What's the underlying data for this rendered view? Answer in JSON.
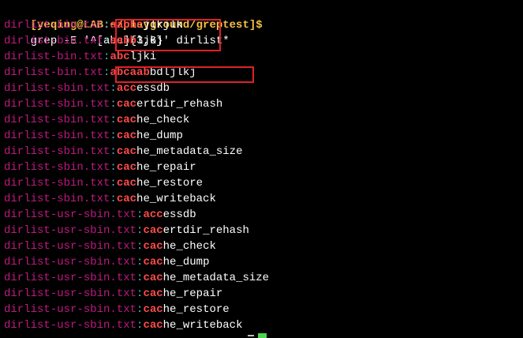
{
  "prompt": "[yeqing@LAB:~/playground/greptest]$",
  "command": "grep -E '^[abc]{3,6}' dirlist*",
  "lines": [
    {
      "file": "dirlist-bin.txt",
      "match": "aabbc",
      "rest": "jlkjlk"
    },
    {
      "file": "dirlist-bin.txt",
      "match": "aabb",
      "rest": "ljkj"
    },
    {
      "file": "dirlist-bin.txt",
      "match": "abc",
      "rest": "ljki"
    },
    {
      "file": "dirlist-bin.txt",
      "match": "abcaab",
      "rest": "bdljlkj"
    },
    {
      "file": "dirlist-sbin.txt",
      "match": "acc",
      "rest": "essdb"
    },
    {
      "file": "dirlist-sbin.txt",
      "match": "cac",
      "rest": "ertdir_rehash"
    },
    {
      "file": "dirlist-sbin.txt",
      "match": "cac",
      "rest": "he_check"
    },
    {
      "file": "dirlist-sbin.txt",
      "match": "cac",
      "rest": "he_dump"
    },
    {
      "file": "dirlist-sbin.txt",
      "match": "cac",
      "rest": "he_metadata_size"
    },
    {
      "file": "dirlist-sbin.txt",
      "match": "cac",
      "rest": "he_repair"
    },
    {
      "file": "dirlist-sbin.txt",
      "match": "cac",
      "rest": "he_restore"
    },
    {
      "file": "dirlist-sbin.txt",
      "match": "cac",
      "rest": "he_writeback"
    },
    {
      "file": "dirlist-usr-sbin.txt",
      "match": "acc",
      "rest": "essdb"
    },
    {
      "file": "dirlist-usr-sbin.txt",
      "match": "cac",
      "rest": "ertdir_rehash"
    },
    {
      "file": "dirlist-usr-sbin.txt",
      "match": "cac",
      "rest": "he_check"
    },
    {
      "file": "dirlist-usr-sbin.txt",
      "match": "cac",
      "rest": "he_dump"
    },
    {
      "file": "dirlist-usr-sbin.txt",
      "match": "cac",
      "rest": "he_metadata_size"
    },
    {
      "file": "dirlist-usr-sbin.txt",
      "match": "cac",
      "rest": "he_repair"
    },
    {
      "file": "dirlist-usr-sbin.txt",
      "match": "cac",
      "rest": "he_restore"
    },
    {
      "file": "dirlist-usr-sbin.txt",
      "match": "cac",
      "rest": "he_writeback"
    }
  ],
  "separator": ":",
  "colors": {
    "background": "#000000",
    "prompt": "#f6c244",
    "filename": "#c0197f",
    "separator": "#48b7c6",
    "match": "#ff4a4a",
    "text": "#ffffff",
    "annotation_box": "#e0202a",
    "cursor": "#4ed24e"
  }
}
